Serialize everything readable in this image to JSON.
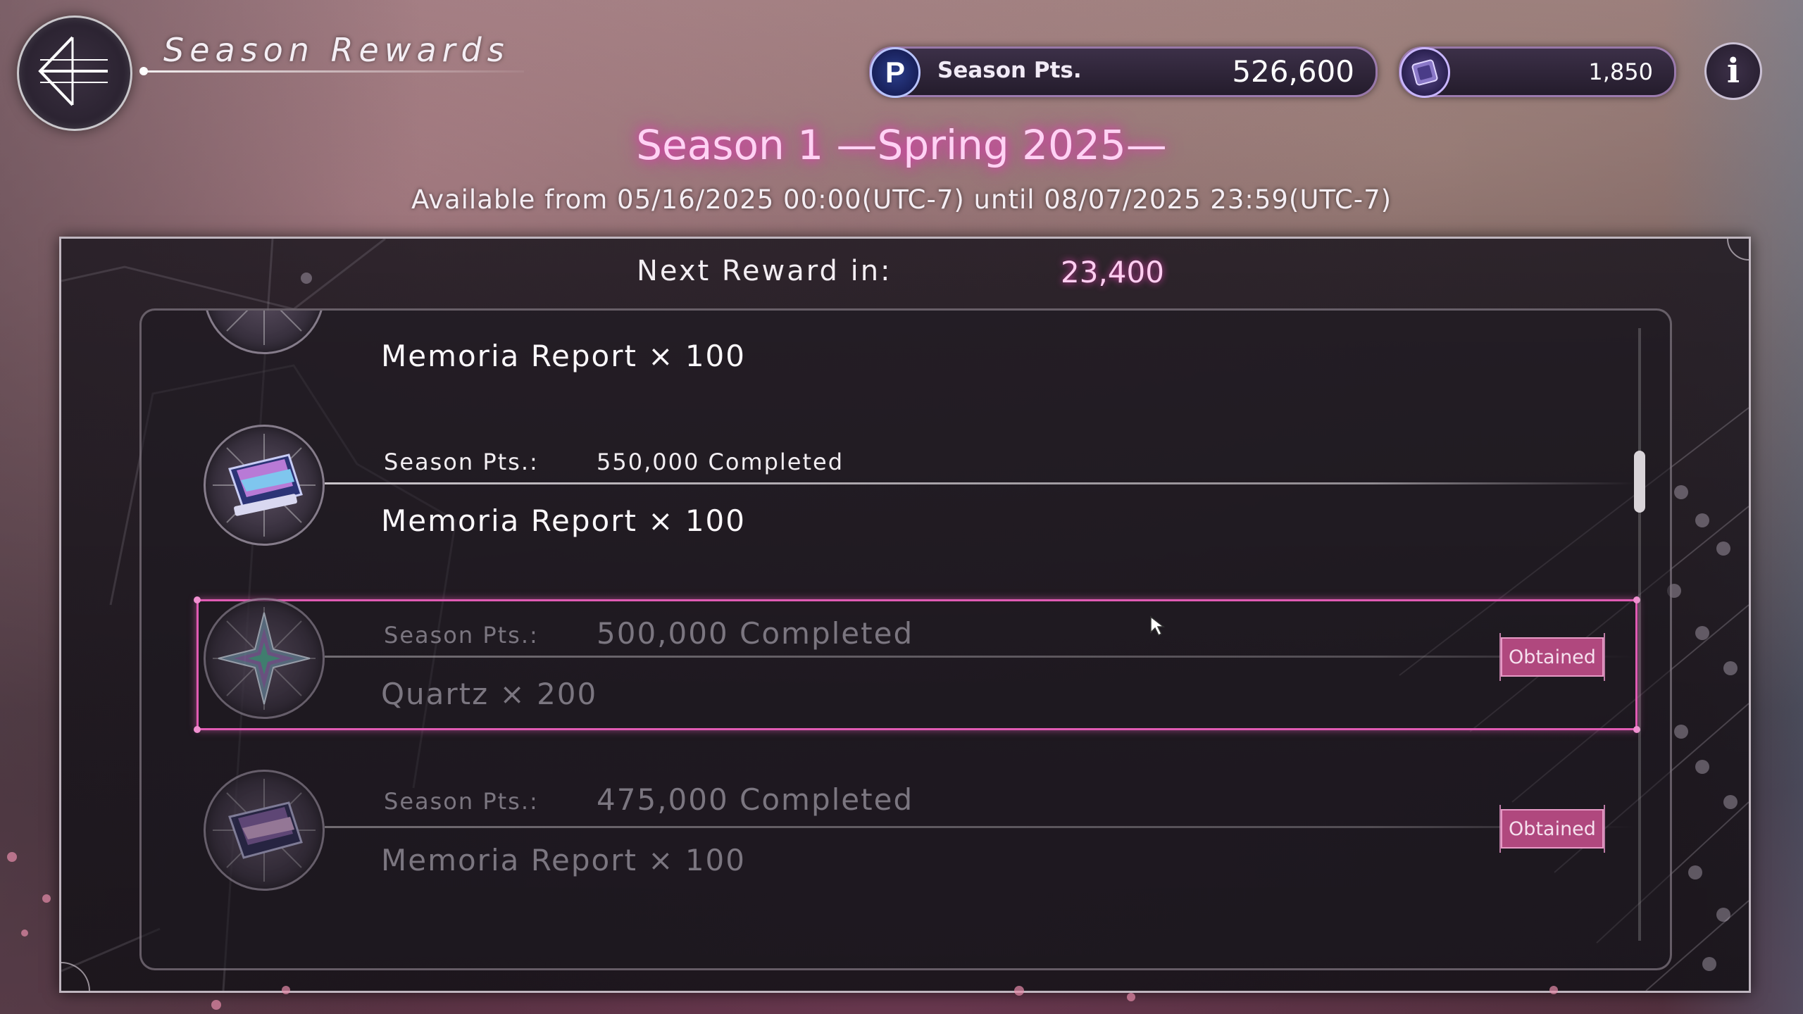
{
  "header": {
    "title": "Season Rewards",
    "season_points": {
      "icon_letter": "P",
      "label": "Season Pts.",
      "value": "526,600"
    },
    "gems": {
      "value": "1,850"
    },
    "back_icon": "back-arrow-icon",
    "info_icon": "info-icon",
    "info_glyph": "i"
  },
  "season": {
    "title": "Season 1 —Spring 2025—",
    "availability": "Available from 05/16/2025 00:00(UTC-7) until 08/07/2025 23:59(UTC-7)"
  },
  "panel": {
    "next_reward_label": "Next Reward in:",
    "next_reward_value": "23,400"
  },
  "rewards": [
    {
      "pts_label": "",
      "pts_value": "",
      "item": "Memoria Report × 100",
      "icon": "memoria-report-icon",
      "obtained": false
    },
    {
      "pts_label": "Season Pts.:",
      "pts_value": "550,000 Completed",
      "item": "Memoria Report × 100",
      "icon": "memoria-report-icon",
      "obtained": false
    },
    {
      "pts_label": "Season Pts.:",
      "pts_value": "500,000 Completed",
      "item": "Quartz × 200",
      "icon": "quartz-icon",
      "obtained": true,
      "status": "Obtained"
    },
    {
      "pts_label": "Season Pts.:",
      "pts_value": "475,000 Completed",
      "item": "Memoria Report × 100",
      "icon": "memoria-report-icon",
      "obtained": true,
      "status": "Obtained"
    }
  ],
  "colors": {
    "accent_pink": "#e05bb3",
    "obtained_badge": "#b0487e",
    "season_title_glow": "#e23fb6"
  }
}
